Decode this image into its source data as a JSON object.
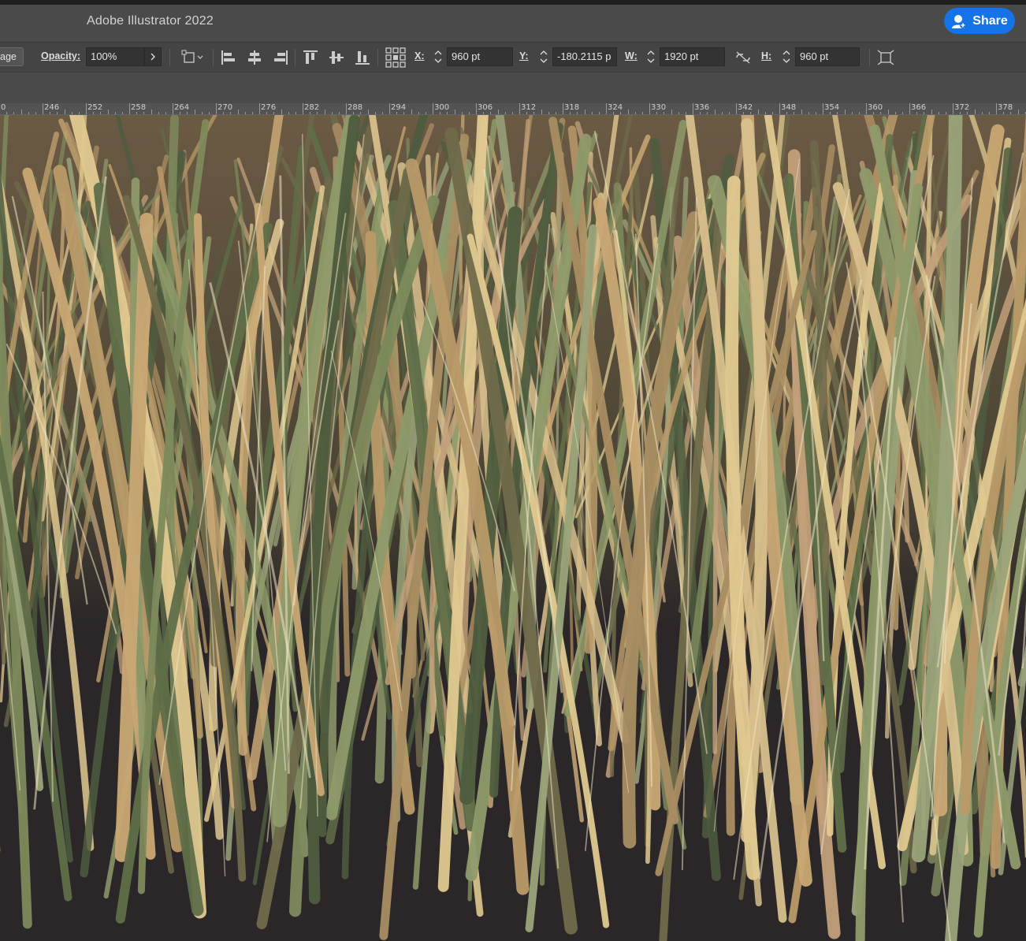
{
  "app": {
    "title": "Adobe Illustrator 2022",
    "share_label": "Share"
  },
  "control_bar": {
    "truncated_label": "age",
    "opacity_label": "Opacity:",
    "opacity_value": "100%",
    "x_label": "X:",
    "x_value": "960 pt",
    "y_label": "Y:",
    "y_value": "-180.2115 p",
    "w_label": "W:",
    "w_value": "1920 pt",
    "h_label": "H:",
    "h_value": "960 pt"
  },
  "ruler": {
    "labels": [
      "0",
      "246",
      "252",
      "258",
      "264",
      "270",
      "276",
      "282",
      "288",
      "294",
      "300",
      "306",
      "312",
      "318",
      "324",
      "330",
      "336",
      "342",
      "348",
      "354",
      "360",
      "366",
      "372",
      "378"
    ]
  },
  "colors": {
    "accent": "#1473e6",
    "canvas_bg": "#2b2628",
    "toolbar": "#444444"
  }
}
